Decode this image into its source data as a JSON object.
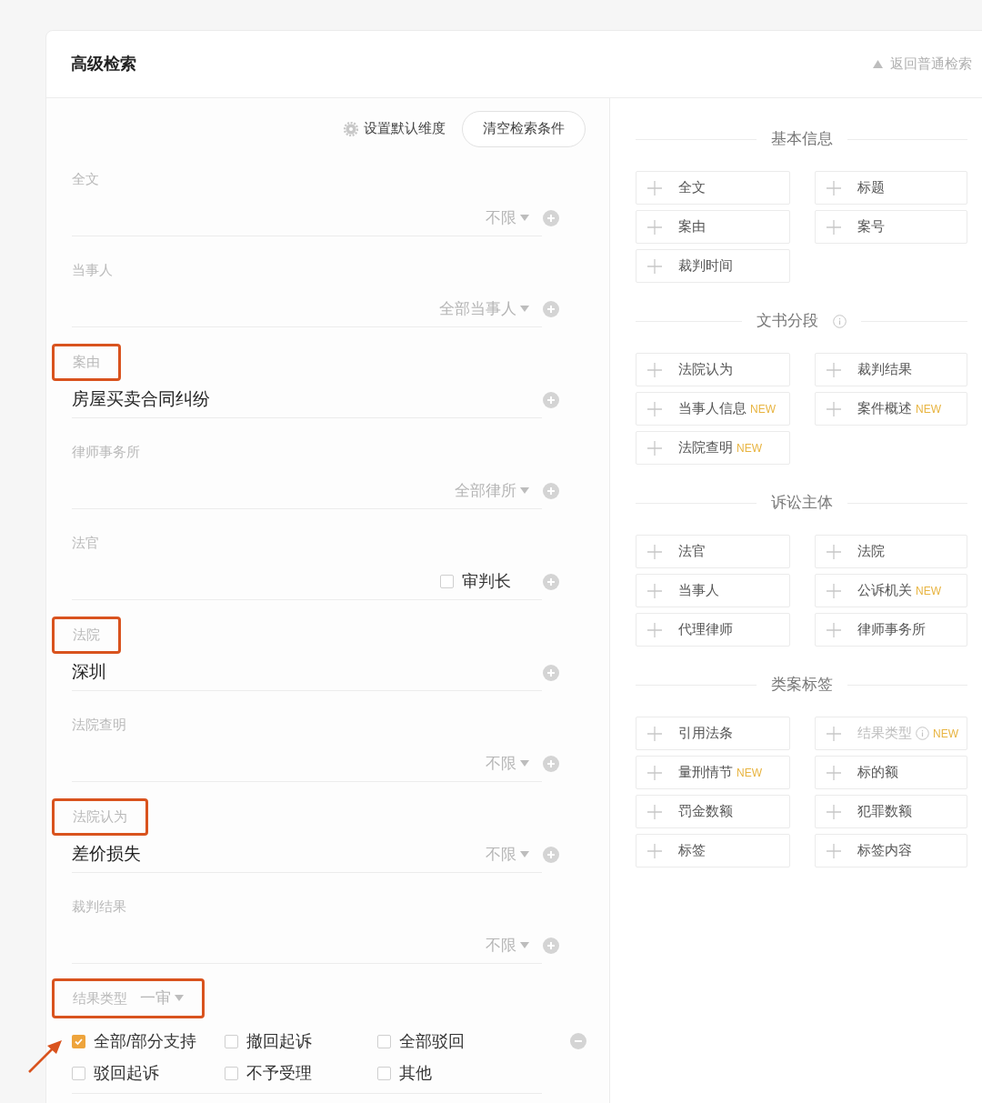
{
  "header": {
    "title": "高级检索",
    "back_link": "返回普通检索"
  },
  "toolbar": {
    "default_link": "设置默认维度",
    "clear_button": "清空检索条件"
  },
  "fields": [
    {
      "kind": "selector",
      "label": "全文",
      "highlighted": false,
      "selector": "不限"
    },
    {
      "kind": "selector",
      "label": "当事人",
      "highlighted": false,
      "selector": "全部当事人"
    },
    {
      "kind": "text",
      "label": "案由",
      "highlighted": true,
      "value": "房屋买卖合同纠纷"
    },
    {
      "kind": "selector",
      "label": "律师事务所",
      "highlighted": false,
      "selector": "全部律所"
    },
    {
      "kind": "checkbox",
      "label": "法官",
      "highlighted": false,
      "checkbox": {
        "label": "审判长",
        "checked": false
      }
    },
    {
      "kind": "text",
      "label": "法院",
      "highlighted": true,
      "value": "深圳"
    },
    {
      "kind": "selector",
      "label": "法院查明",
      "highlighted": false,
      "selector": "不限"
    },
    {
      "kind": "selector",
      "label": "法院认为",
      "highlighted": true,
      "value": "差价损失",
      "selector": "不限"
    },
    {
      "kind": "selector",
      "label": "裁判结果",
      "highlighted": false,
      "selector": "不限"
    },
    {
      "kind": "options",
      "label": "结果类型",
      "highlighted": true,
      "selector": "一审",
      "options": [
        {
          "label": "全部/部分支持",
          "checked": true
        },
        {
          "label": "撤回起诉",
          "checked": false
        },
        {
          "label": "全部驳回",
          "checked": false
        },
        {
          "label": "驳回起诉",
          "checked": false
        },
        {
          "label": "不予受理",
          "checked": false
        },
        {
          "label": "其他",
          "checked": false
        }
      ]
    }
  ],
  "sections": [
    {
      "title": "基本信息",
      "info": false,
      "items": [
        {
          "label": "全文",
          "disabled": false
        },
        {
          "label": "标题",
          "disabled": false
        },
        {
          "label": "案由",
          "disabled": false
        },
        {
          "label": "案号",
          "disabled": false
        },
        {
          "label": "裁判时间",
          "disabled": false
        }
      ]
    },
    {
      "title": "文书分段",
      "info": true,
      "items": [
        {
          "label": "法院认为",
          "disabled": false
        },
        {
          "label": "裁判结果",
          "disabled": false
        },
        {
          "label": "当事人信息",
          "badge": "NEW",
          "disabled": false
        },
        {
          "label": "案件概述",
          "badge": "NEW",
          "disabled": false
        },
        {
          "label": "法院查明",
          "badge": "NEW",
          "disabled": false
        }
      ]
    },
    {
      "title": "诉讼主体",
      "info": false,
      "items": [
        {
          "label": "法官",
          "disabled": false
        },
        {
          "label": "法院",
          "disabled": false
        },
        {
          "label": "当事人",
          "disabled": false
        },
        {
          "label": "公诉机关",
          "badge": "NEW",
          "disabled": false
        },
        {
          "label": "代理律师",
          "disabled": false
        },
        {
          "label": "律师事务所",
          "disabled": false
        }
      ]
    },
    {
      "title": "类案标签",
      "info": false,
      "items": [
        {
          "label": "引用法条",
          "disabled": false
        },
        {
          "label": "结果类型",
          "info": true,
          "badge": "NEW",
          "disabled": true
        },
        {
          "label": "量刑情节",
          "badge": "NEW",
          "disabled": false
        },
        {
          "label": "标的额",
          "disabled": false
        },
        {
          "label": "罚金数额",
          "disabled": false
        },
        {
          "label": "犯罪数额",
          "disabled": false
        },
        {
          "label": "标签",
          "disabled": false
        },
        {
          "label": "标签内容",
          "disabled": false
        }
      ]
    }
  ]
}
